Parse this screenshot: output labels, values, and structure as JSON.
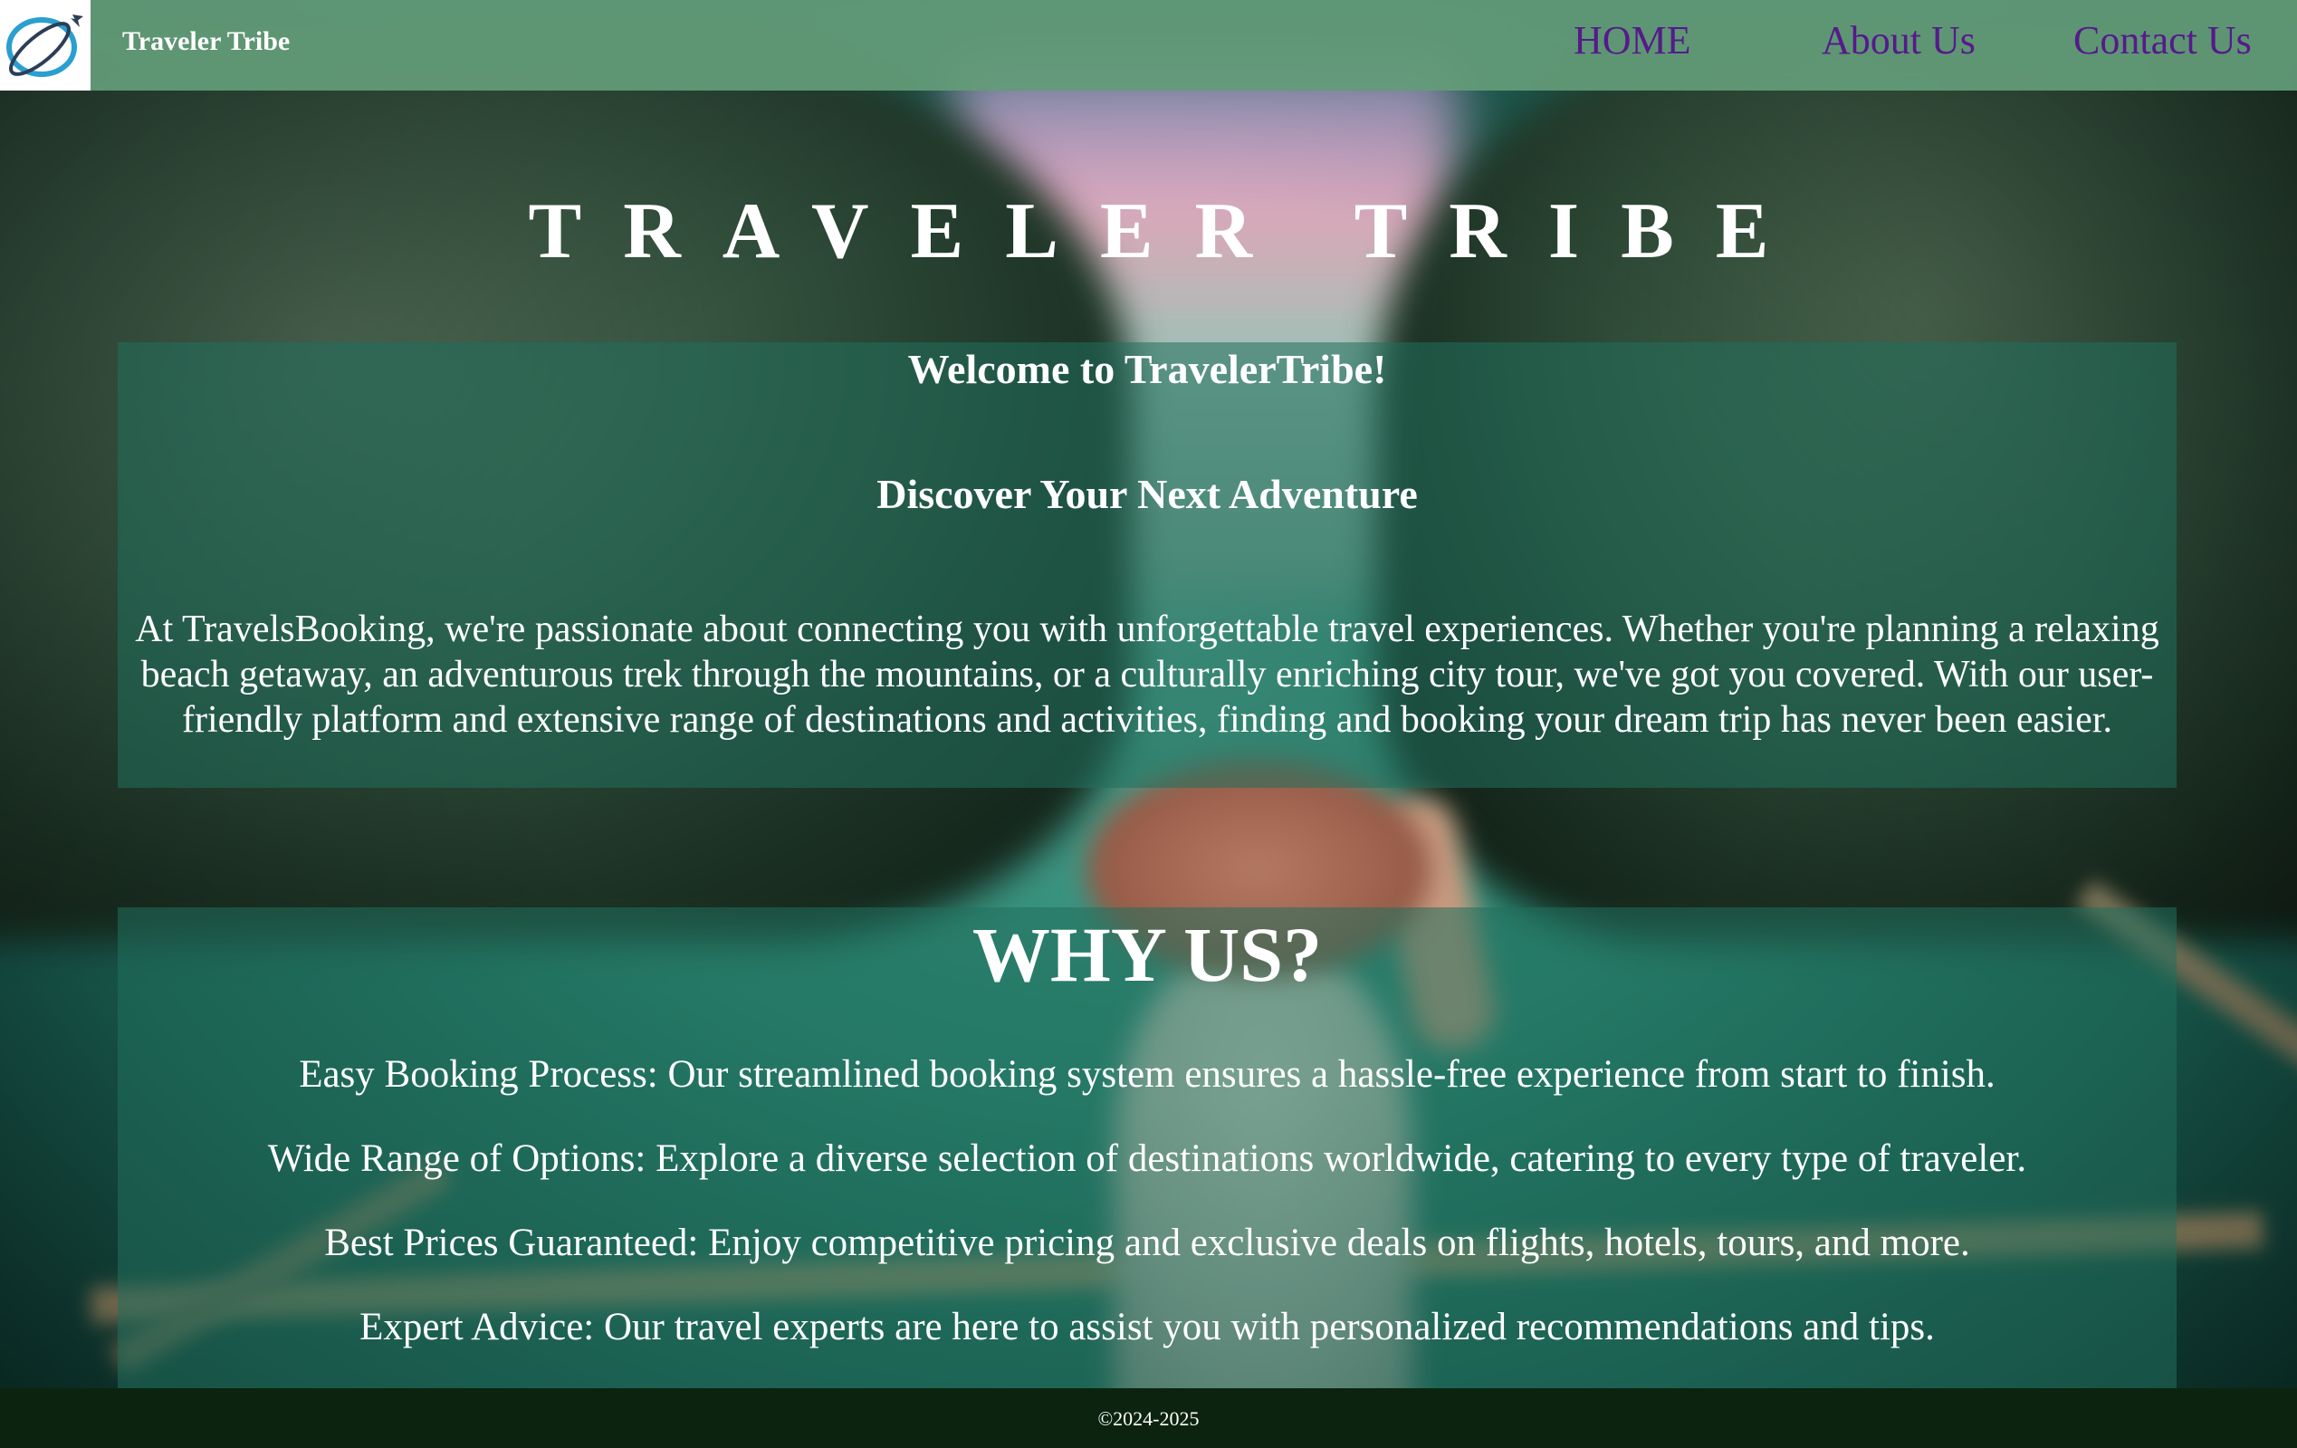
{
  "header": {
    "brand": "Traveler Tribe",
    "nav": [
      {
        "label": "HOME"
      },
      {
        "label": "About Us"
      },
      {
        "label": "Contact Us"
      }
    ],
    "link_color": "#551a8b"
  },
  "hero": {
    "title": "TRAVELER TRIBE"
  },
  "welcome": {
    "heading": "Welcome to TravelerTribe!",
    "subheading": "Discover Your Next Adventure",
    "text": "At TravelsBooking, we're passionate about connecting you with unforgettable travel experiences. Whether you're planning a relaxing beach getaway, an adventurous trek through the mountains, or a culturally enriching city tour, we've got you covered. With our user-friendly platform and extensive range of destinations and activities, finding and booking your dream trip has never been easier."
  },
  "why": {
    "heading": "WHY US?",
    "items": [
      "Easy Booking Process: Our streamlined booking system ensures a hassle-free experience from start to finish.",
      "Wide Range of Options: Explore a diverse selection of destinations worldwide, catering to every type of traveler.",
      "Best Prices Guaranteed: Enjoy competitive pricing and exclusive deals on flights, hotels, tours, and more.",
      "Expert Advice: Our travel experts are here to assist you with personalized recommendations and tips."
    ]
  },
  "footer": {
    "copyright": "©2024-2025"
  },
  "icons": {
    "logo": "globe-plane-logo-icon"
  },
  "colors": {
    "header_bg": "#639c78",
    "footer_bg": "#0c240f",
    "panel_bg": "#20705c"
  }
}
